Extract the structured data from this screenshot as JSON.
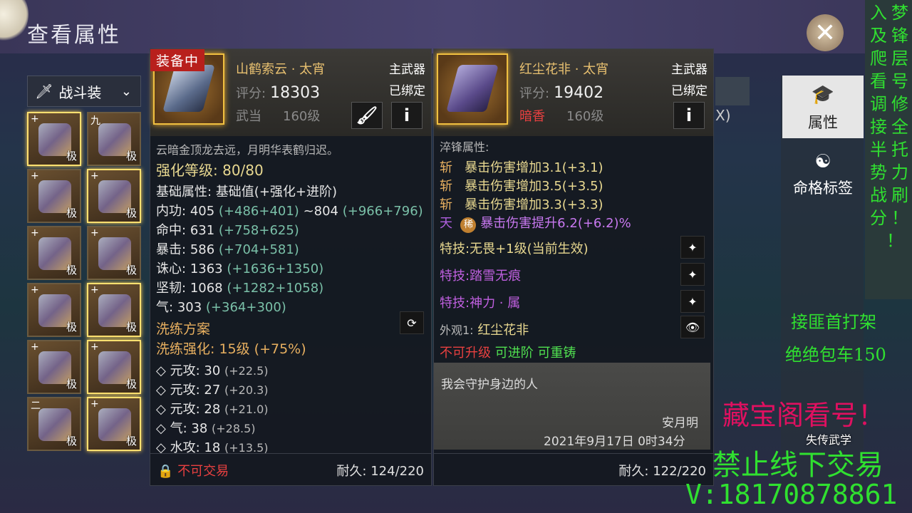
{
  "page_title": "查看属性",
  "outfit": {
    "icon": "sword-icon",
    "label": "战斗装",
    "chevron": "chevron-down-icon"
  },
  "slots": [
    {
      "mark": "+",
      "grade": "极"
    },
    {
      "mark": "九",
      "grade": "极"
    },
    {
      "mark": "+",
      "grade": "极"
    },
    {
      "mark": "+",
      "grade": "极"
    },
    {
      "mark": "+",
      "grade": "极"
    },
    {
      "mark": "+",
      "grade": "极"
    },
    {
      "mark": "+",
      "grade": "极"
    },
    {
      "mark": "+",
      "grade": "极"
    },
    {
      "mark": "+",
      "grade": "极"
    },
    {
      "mark": "+",
      "grade": "极"
    },
    {
      "mark": "二",
      "grade": "极"
    },
    {
      "mark": "+",
      "grade": "极"
    }
  ],
  "left_item": {
    "tag": "装备中",
    "name": "山鹤索云 · 太宵",
    "score_label": "评分:",
    "score": "18303",
    "school": "武当",
    "level": "160级",
    "slot_type": "主武器",
    "bound": "已绑定",
    "flavor": "云暗金顶龙去远，月明华表鹤归迟。",
    "enhance_label": "强化等级:",
    "enhance_val": "80/80",
    "base_label": "基础属性:",
    "base_desc": "基础值(+强化+进阶)",
    "stats": [
      {
        "name": "内功:",
        "val": "405",
        "extra": "(+486+401)",
        "val2": "~804",
        "extra2": "(+966+796)"
      },
      {
        "name": "命中:",
        "val": "631",
        "extra": "(+758+625)"
      },
      {
        "name": "暴击:",
        "val": "586",
        "extra": "(+704+581)"
      },
      {
        "name": "诛心:",
        "val": "1363",
        "extra": "(+1636+1350)"
      },
      {
        "name": "坚韧:",
        "val": "1068",
        "extra": "(+1282+1058)"
      },
      {
        "name": "气:",
        "val": "303",
        "extra": "(+364+300)"
      }
    ],
    "refine_title": "洗练方案",
    "refine_level_label": "洗练强化:",
    "refine_level": "15级 (+75%)",
    "refine_stats": [
      {
        "name": "元攻:",
        "val": "30",
        "extra": "(+22.5)"
      },
      {
        "name": "元攻:",
        "val": "27",
        "extra": "(+20.3)"
      },
      {
        "name": "元攻:",
        "val": "28",
        "extra": "(+21.0)"
      },
      {
        "name": "气:",
        "val": "38",
        "extra": "(+28.5)"
      },
      {
        "name": "水攻:",
        "val": "18",
        "extra": "(+13.5)"
      }
    ],
    "trade": "不可交易",
    "durability_label": "耐久:",
    "durability": "124/220"
  },
  "right_item": {
    "name": "红尘花非 · 太宵",
    "score_label": "评分:",
    "score": "19402",
    "school": "暗香",
    "level": "160级",
    "slot_type": "主武器",
    "bound": "已绑定",
    "section": "淬锋属性:",
    "forge": [
      {
        "tag": "斩",
        "text": "暴击伤害增加3.1(+3.1)"
      },
      {
        "tag": "斩",
        "text": "暴击伤害增加3.5(+3.5)"
      },
      {
        "tag": "斩",
        "text": "暴击伤害增加3.3(+3.3)"
      },
      {
        "tag": "天",
        "badge": "稀",
        "text": "暴击伤害提升6.2(+6.2)%"
      }
    ],
    "skills": [
      {
        "label": "特技:",
        "name": "无畏+1级(当前生效)"
      },
      {
        "label": "特技:",
        "name": "踏雪无痕"
      },
      {
        "label": "特技:",
        "name": "神力 · 属"
      }
    ],
    "appearance_label": "外观1:",
    "appearance": "红尘花非",
    "no_upgrade": "不可升级",
    "can_advance": "可进阶",
    "can_reforge": "可重铸",
    "note": "我会守护身边的人",
    "signer": "安月明",
    "date": "2021年9月17日 0时34分",
    "durability_label": "耐久:",
    "durability": "122/220"
  },
  "tabs": [
    {
      "label": "属性",
      "icon": "hat-icon"
    },
    {
      "label": "命格标签",
      "icon": "taiji-icon"
    }
  ],
  "bg_text": "X)",
  "overlay": {
    "col1": [
      "入",
      "及",
      "爬",
      "看",
      "调",
      "接",
      "半",
      "势",
      "战",
      "分",
      "！"
    ],
    "col2": [
      "梦",
      "锋",
      "层",
      "号",
      "修",
      "全",
      "托",
      "力",
      "刷",
      "！"
    ],
    "line1": "接匪首打架",
    "line2": "绝绝包车150",
    "line3": "藏宝阁看号！",
    "line4": "禁止线下交易",
    "line5": "V:18170878861",
    "logo": "失传武学"
  }
}
